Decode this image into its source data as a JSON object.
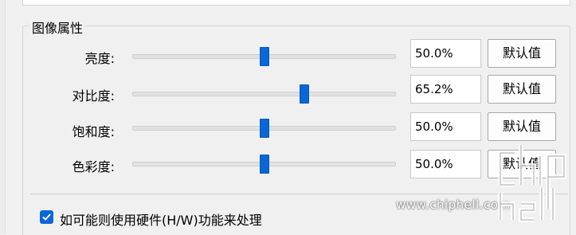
{
  "group": {
    "title": "图像属性"
  },
  "rows": [
    {
      "label": "亮度:",
      "value": "50.0%",
      "slider_fraction": 0.5,
      "button": "默认值"
    },
    {
      "label": "对比度:",
      "value": "65.2%",
      "slider_fraction": 0.652,
      "button": "默认值"
    },
    {
      "label": "饱和度:",
      "value": "50.0%",
      "slider_fraction": 0.5,
      "button": "默认值"
    },
    {
      "label": "色彩度:",
      "value": "50.0%",
      "slider_fraction": 0.5,
      "button": "默认值"
    }
  ],
  "hardware": {
    "checked": true,
    "label": "如可能则使用硬件(H/W)功能来处理"
  },
  "watermark": {
    "text": "www.chiphell.com",
    "logo": "chiphell-logo"
  },
  "colors": {
    "accent": "#0b66d6",
    "track": "#e1e1e1",
    "background": "#f0f0f0"
  }
}
